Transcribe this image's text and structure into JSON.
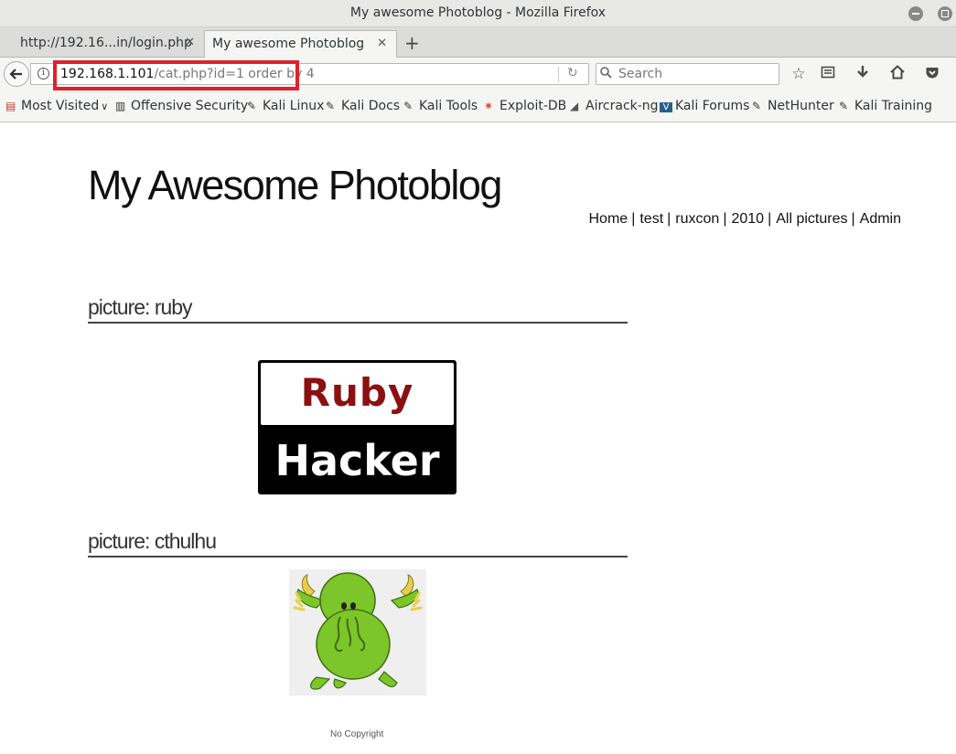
{
  "window": {
    "title": "My awesome Photoblog - Mozilla Firefox"
  },
  "tabs": [
    {
      "label": "http://192.16...in/login.php",
      "close": "✕"
    },
    {
      "label": "My awesome Photoblog",
      "close": "✕"
    }
  ],
  "newtab_label": "+",
  "navbar": {
    "url_host": "192.168.1.101",
    "url_path": "/cat.php?id=1 order by 4",
    "search_placeholder": "Search"
  },
  "bookmarks": [
    {
      "label": "Most Visited",
      "icon": "folder-icon"
    },
    {
      "label": "Offensive Security",
      "icon": "offsec-icon"
    },
    {
      "label": "Kali Linux",
      "icon": "kali-dragon-icon"
    },
    {
      "label": "Kali Docs",
      "icon": "kali-dragon-icon"
    },
    {
      "label": "Kali Tools",
      "icon": "kali-dragon-icon"
    },
    {
      "label": "Exploit-DB",
      "icon": "exploitdb-icon"
    },
    {
      "label": "Aircrack-ng",
      "icon": "aircrack-icon"
    },
    {
      "label": "Kali Forums",
      "icon": "kali-forums-icon"
    },
    {
      "label": "NetHunter",
      "icon": "kali-dragon-icon"
    },
    {
      "label": "Kali Training",
      "icon": "kali-dragon-icon"
    }
  ],
  "site": {
    "title": "My Awesome Photoblog",
    "nav": [
      "Home",
      "test",
      "ruxcon",
      "2010",
      "All pictures",
      "Admin"
    ],
    "nav_separator": "|",
    "pictures": [
      {
        "heading": "picture: ruby",
        "image_text_top": "Ruby",
        "image_text_bottom": "Hacker"
      },
      {
        "heading": "picture: cthulhu"
      }
    ],
    "footer": "No Copyright"
  },
  "colors": {
    "url_highlight": "#e0202a",
    "ruby_red": "#8b1012",
    "cthulhu_green": "#7cc52b"
  }
}
